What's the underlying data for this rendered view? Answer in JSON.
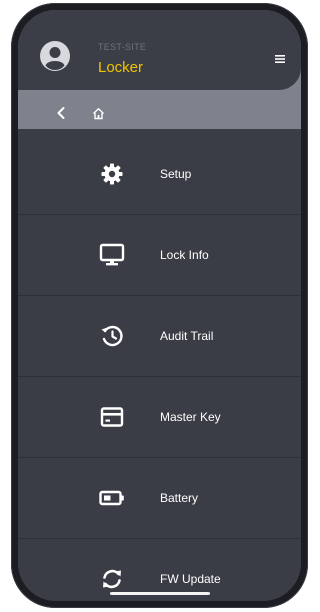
{
  "header": {
    "site": "TEST-SITE",
    "title": "Locker"
  },
  "colors": {
    "accent": "#f1c400",
    "background": "#3a3d45",
    "subheader": "#7d828d"
  },
  "nav": {
    "back_icon": "chevron-left-icon",
    "home_icon": "home-icon"
  },
  "menu": [
    {
      "label": "Setup",
      "icon": "gear-icon"
    },
    {
      "label": "Lock Info",
      "icon": "monitor-icon"
    },
    {
      "label": "Audit Trail",
      "icon": "history-icon"
    },
    {
      "label": "Master Key",
      "icon": "credit-card-icon"
    },
    {
      "label": "Battery",
      "icon": "battery-icon"
    },
    {
      "label": "FW Update",
      "icon": "sync-icon"
    }
  ]
}
